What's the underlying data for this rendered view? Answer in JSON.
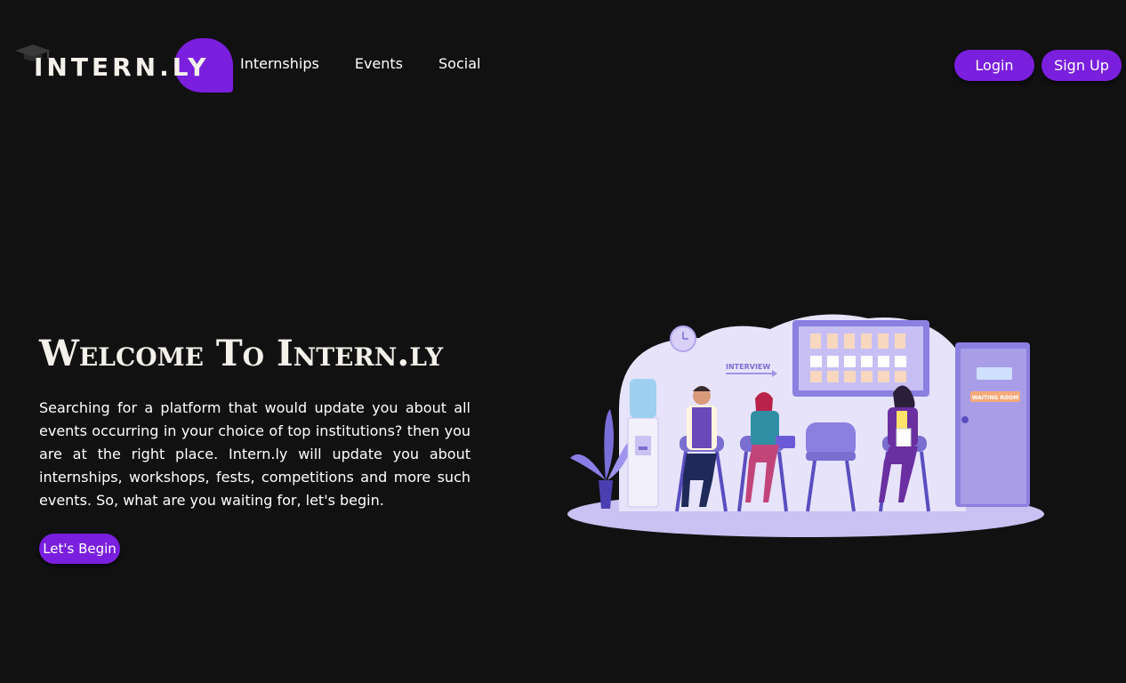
{
  "brand": {
    "name": "INTERN.LY",
    "accent_color": "#7a1fde",
    "background_color": "#121112"
  },
  "nav": {
    "links": [
      {
        "label": "Internships"
      },
      {
        "label": "Events"
      },
      {
        "label": "Social"
      }
    ],
    "login_label": "Login",
    "signup_label": "Sign Up"
  },
  "hero": {
    "title": "Welcome To Intern.ly",
    "description": "Searching for a platform that would update you about all events occurring in your choice of top institutions? then you are at the right place. Intern.ly will update you about internships, workshops, fests, competitions and more such events. So, what are you waiting for, let's begin.",
    "cta_label": "Let's Begin"
  },
  "illustration": {
    "interview_sign": "INTERVIEW",
    "door_sign": "WAITING ROOM",
    "icons": [
      "graduation-cap-icon",
      "clock-icon",
      "water-cooler-icon",
      "plant-icon",
      "door-icon"
    ]
  }
}
